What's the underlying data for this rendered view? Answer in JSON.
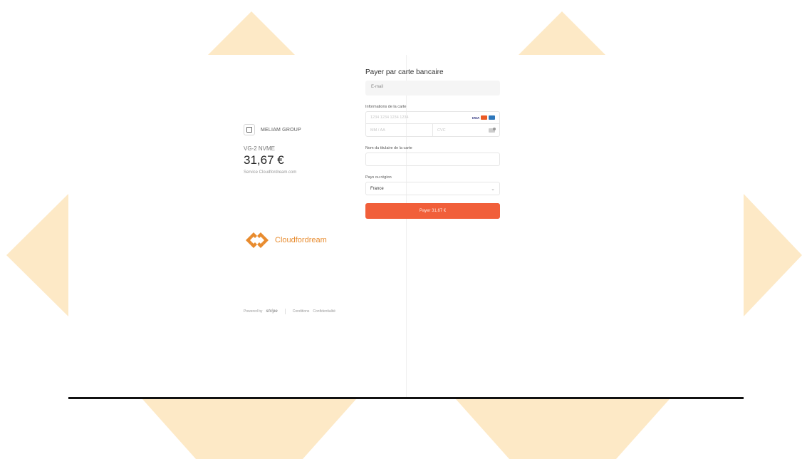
{
  "merchant": {
    "name": "MELIAM GROUP"
  },
  "order": {
    "product": "VG-2 NVME",
    "price": "31,67 €",
    "service": "Service Cloudfordream.com"
  },
  "brand": {
    "name": "Cloudfordream",
    "color": "#e88b2e"
  },
  "footer": {
    "powered_by": "Powered by",
    "stripe": "stripe",
    "conditions": "Conditions",
    "privacy": "Confidentialité"
  },
  "form": {
    "title": "Payer par carte bancaire",
    "email_placeholder": "E-mail",
    "card_label": "Informations de la carte",
    "card_number_placeholder": "1234 1234 1234 1234",
    "card_brands": {
      "visa": "VISA"
    },
    "expiry_placeholder": "MM / AA",
    "cvc_placeholder": "CVC",
    "holder_label": "Nom du titulaire de la carte",
    "country_label": "Pays ou région",
    "country_value": "France",
    "pay_label": "Payer 31,67 €"
  },
  "colors": {
    "accent": "#f15f3a",
    "decor": "#fde9c6"
  }
}
